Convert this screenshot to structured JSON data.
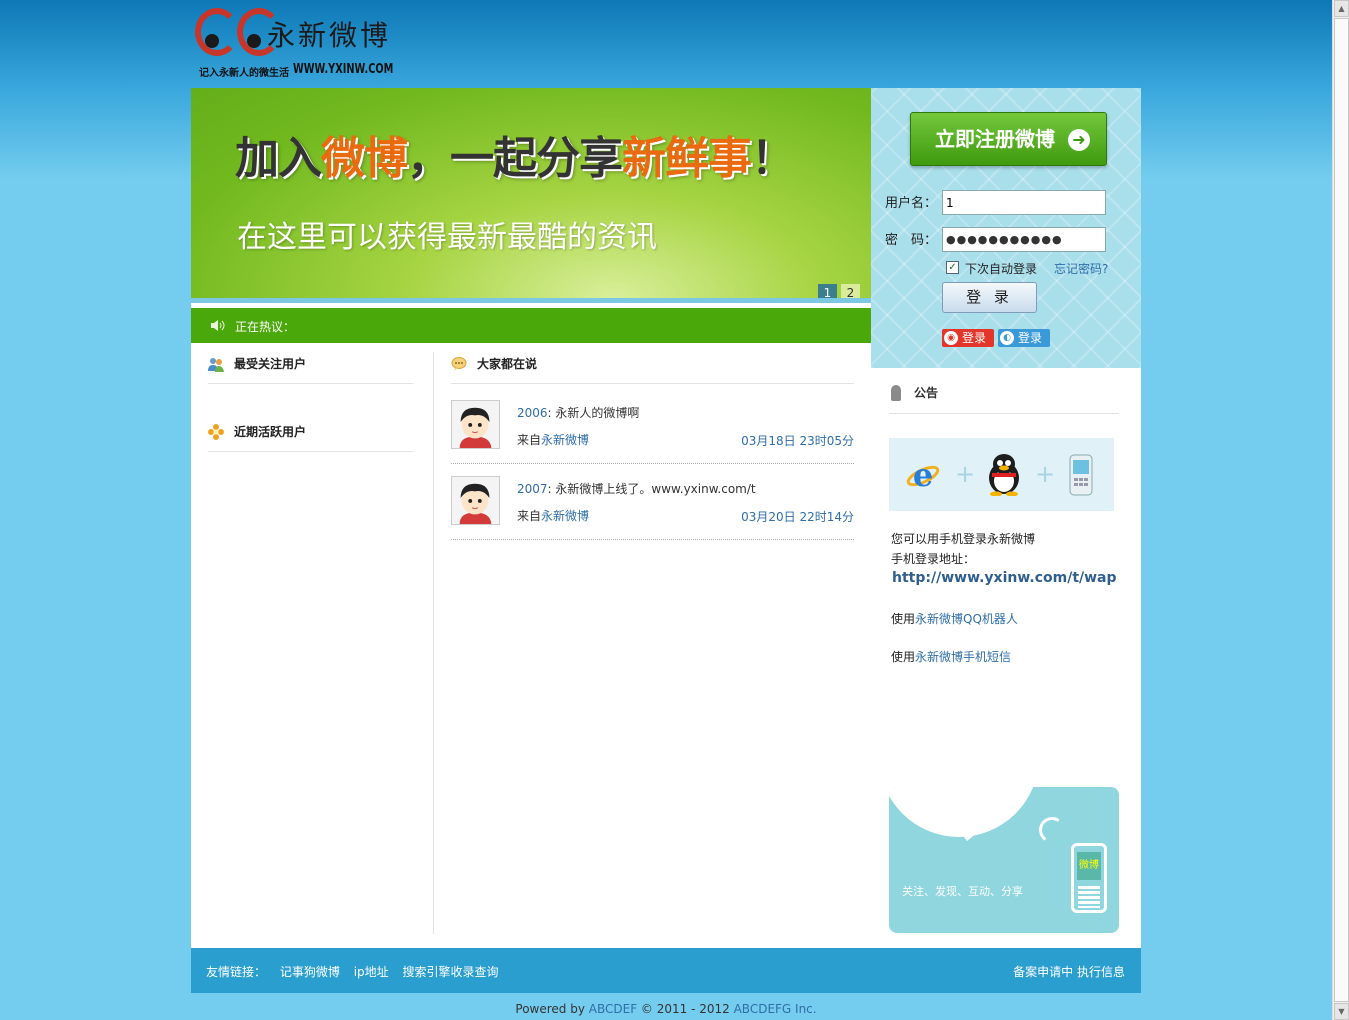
{
  "header": {
    "logo_text": "永新微博",
    "slogan": "记入永新人的微生活",
    "site_url": "WWW.YXINW.COM"
  },
  "banner": {
    "title_parts": [
      "加入",
      "微博",
      "，一起分享",
      "新鲜事",
      "！"
    ],
    "subtitle": "在这里可以获得最新最酷的资讯",
    "slides": [
      "1",
      "2"
    ],
    "active_slide": "1"
  },
  "hot_bar": {
    "label": "正在热议："
  },
  "left": {
    "popular_users": "最受关注用户",
    "active_users": "近期活跃用户"
  },
  "center": {
    "title": "大家都在说",
    "posts": [
      {
        "user": "2006",
        "text": "永新人的微博啊",
        "source_prefix": "来自",
        "source": "永新微博",
        "time": "03月18日  23时05分"
      },
      {
        "user": "2007",
        "text": "永新微博上线了。www.yxinw.com/t",
        "source_prefix": "来自",
        "source": "永新微博",
        "time": "03月20日  22时14分"
      }
    ]
  },
  "login": {
    "register_label": "立即注册微博",
    "username_label": "用户名：",
    "username_value": "1",
    "password_label": "密　码：",
    "password_value": "●●●●●●●●●●●",
    "remember_label": "下次自动登录",
    "remember_checked": "✓",
    "forgot_label": "忘记密码?",
    "login_label": "登 录",
    "sina_label": "登录",
    "qq_label": "登录"
  },
  "notice": {
    "title": "公告",
    "line1": "您可以用手机登录永新微博",
    "line2": "手机登录地址：",
    "wap_url": "http://www.yxinw.com/t/wap",
    "qq_prefix": "使用",
    "qq_link": "永新微博QQ机器人",
    "sms_prefix": "使用",
    "sms_link": "永新微博手机短信",
    "promo_slogan": "关注、发现、互动、分享",
    "promo_phone_label": "微博"
  },
  "footer": {
    "links_label": "友情链接：",
    "links": [
      "记事狗微博",
      "ip地址",
      "搜索引擎收录查询"
    ],
    "right": [
      "备案申请中",
      "执行信息"
    ]
  },
  "powered": {
    "prefix": "Powered by ",
    "brand": "ABCDEF",
    "middle": " © 2011 - 2012 ",
    "company": "ABCDEFG Inc."
  },
  "colors": {
    "accent_orange": "#ea6a0f",
    "hot_green": "#4aa80a",
    "link_blue": "#2f6ea8",
    "footer_blue": "#2b9ed0"
  }
}
